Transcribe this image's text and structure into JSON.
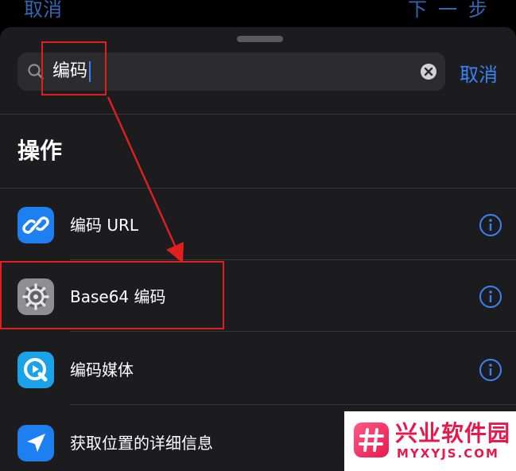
{
  "background": {
    "left_text": "取消",
    "right_text": "下一步"
  },
  "search": {
    "value": "编码",
    "cancel_label": "取消"
  },
  "section": {
    "title": "操作"
  },
  "actions": [
    {
      "label": "编码 URL",
      "icon": "link-icon",
      "color": "#1e7ff0"
    },
    {
      "label": "Base64 编码",
      "icon": "gear-icon",
      "color": "#8e8e93"
    },
    {
      "label": "编码媒体",
      "icon": "quicktime-icon",
      "color": "#1aa3e8"
    },
    {
      "label": "获取位置的详细信息",
      "icon": "location-arrow-icon",
      "color": "#1e7ff0"
    }
  ],
  "watermark": {
    "title": "兴业软件园",
    "subtitle": "MYXYJS.COM"
  },
  "colors": {
    "accent": "#3a82f7",
    "highlight": "#e0201f",
    "sheet": "#1c1c1e"
  }
}
